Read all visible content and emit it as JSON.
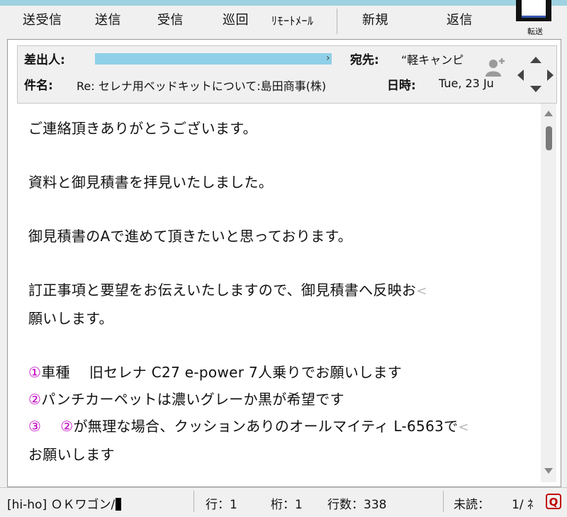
{
  "toolbar": {
    "send_receive": "送受信",
    "send": "送信",
    "receive": "受信",
    "patrol": "巡回",
    "remote_mail": "ﾘﾓｰﾄﾒｰﾙ",
    "new": "新規",
    "reply": "返信",
    "forward": "転送"
  },
  "header": {
    "from_label": "差出人:",
    "to_label": "宛先:",
    "to_value": "“軽キャンピ",
    "subject_label": "件名:",
    "subject_value": "Re: セレナ用ベッドキットについて:島田商事(株)",
    "date_label": "日時:",
    "date_value": "Tue, 23 Ju"
  },
  "body": {
    "lines": [
      "ご連絡頂きありがとうございます。",
      "",
      "資料と御見積書を拝見いたしました。",
      "",
      "御見積書のAで進めて頂きたいと思っております。",
      "",
      "訂正事項と要望をお伝えいたしますので、御見積書へ反映お",
      "願いします。",
      "",
      "①車種　 旧セレナ C27 e-power 7人乗りでお願いします",
      "②パンチカーペットは濃いグレーか黒が希望です",
      "③　 ②が無理な場合、クッションありのオールマイティ L-6563で",
      "お願いします"
    ]
  },
  "status": {
    "account": "[hi-ho] ＯＫワゴン/",
    "row": "行：1",
    "col": "桁：1",
    "line_count": "行数：338",
    "unread": "未読：",
    "page": "1/ ",
    "page_tail": "ﾈ"
  },
  "colors": {
    "accent_circle_numbers": "#c000c0",
    "redacted_bar": "#8fd0e8",
    "q_icon": "#c00000"
  }
}
